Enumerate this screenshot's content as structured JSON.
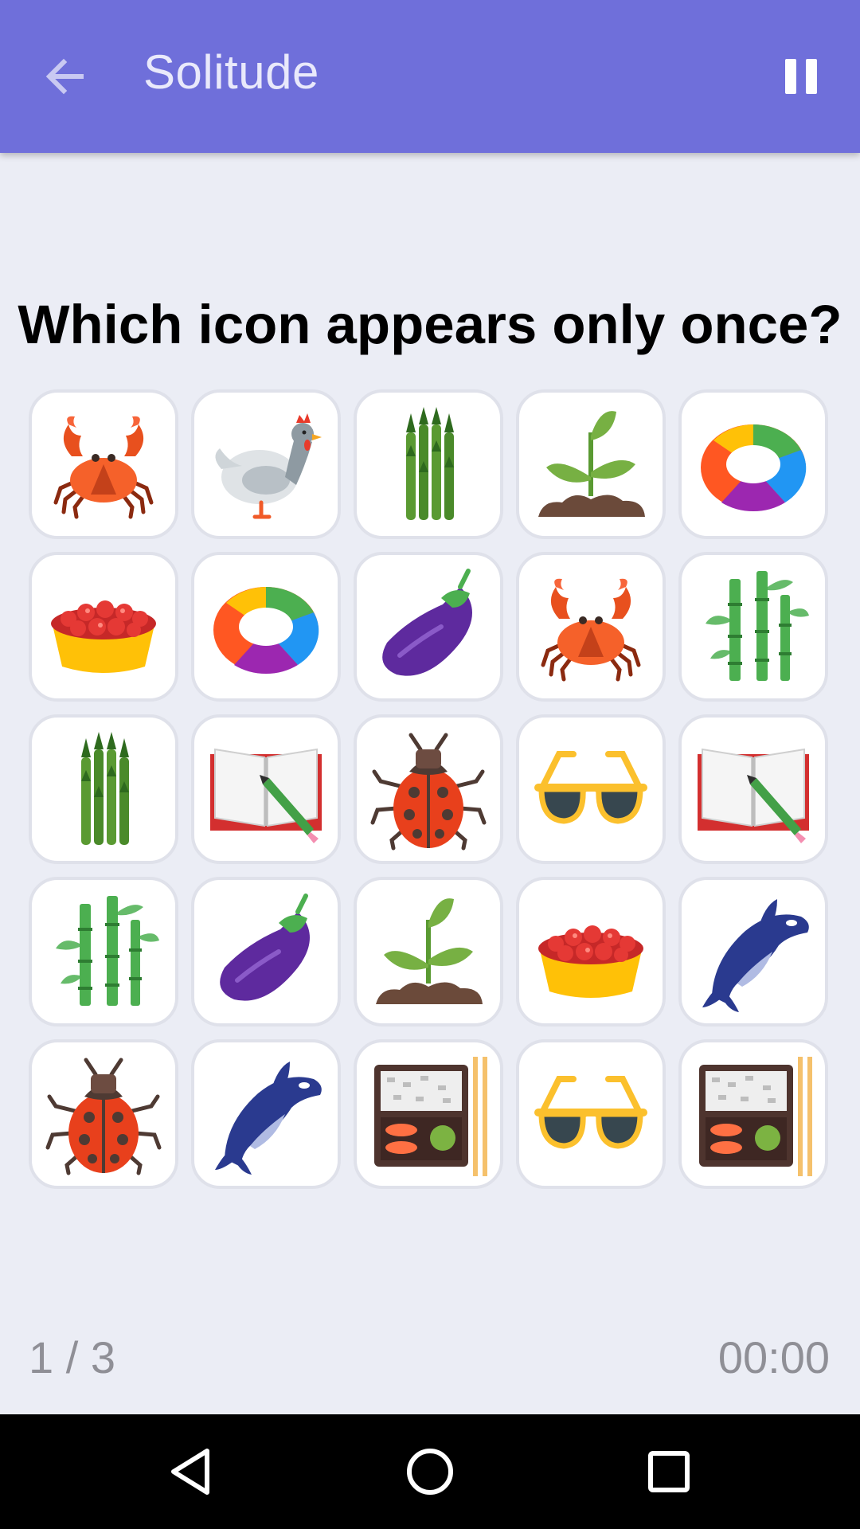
{
  "app": {
    "title": "Solitude",
    "bar_color": "#6f6fda"
  },
  "toolbar": {
    "back_icon": "arrow-left-icon",
    "pause_icon": "pause-icon"
  },
  "question": "Which icon appears only once?",
  "grid": {
    "rows": [
      [
        "crab",
        "rooster",
        "asparagus",
        "seedling",
        "color-ring"
      ],
      [
        "tart",
        "color-ring",
        "eggplant",
        "crab",
        "bamboo"
      ],
      [
        "asparagus",
        "book-pencil",
        "ladybug",
        "sunglasses",
        "book-pencil"
      ],
      [
        "bamboo",
        "eggplant",
        "seedling",
        "tart",
        "orca"
      ],
      [
        "ladybug",
        "orca",
        "bento",
        "sunglasses",
        "bento"
      ]
    ]
  },
  "footer": {
    "level": "1 / 3",
    "timer": "00:00"
  },
  "navigation": {
    "back_icon": "nav-back-icon",
    "home_icon": "nav-home-icon",
    "recents_icon": "nav-recents-icon"
  }
}
